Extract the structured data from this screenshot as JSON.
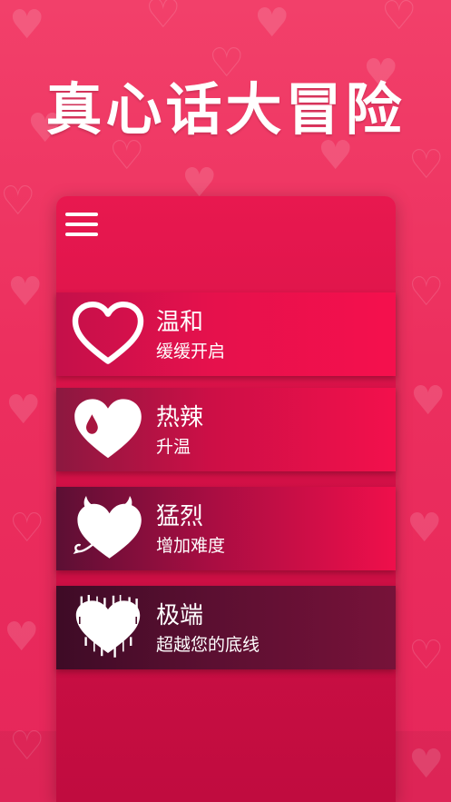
{
  "app": {
    "title": "真心话大冒险"
  },
  "modes": [
    {
      "name": "温和",
      "desc": "缓缓开启",
      "icon": "heart-outline-icon"
    },
    {
      "name": "热辣",
      "desc": "升温",
      "icon": "heart-drop-icon"
    },
    {
      "name": "猛烈",
      "desc": "增加难度",
      "icon": "devil-heart-icon"
    },
    {
      "name": "极端",
      "desc": "超越您的底线",
      "icon": "broken-edge-heart-icon"
    }
  ],
  "colors": {
    "background": "#ec2f5e",
    "panel": "#d11046",
    "text": "#ffffff"
  },
  "menu": {
    "icon": "hamburger-menu-icon"
  }
}
